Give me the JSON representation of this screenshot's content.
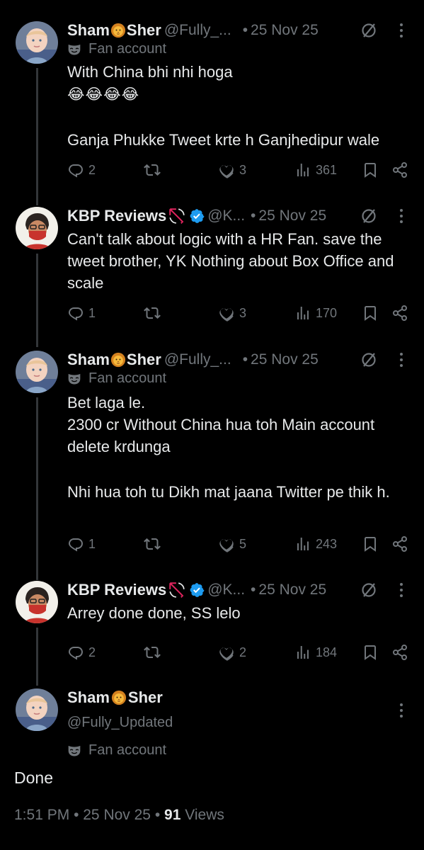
{
  "tweets": [
    {
      "name": "Sham",
      "name2": "Sher",
      "handle": "@Fully_...",
      "date": "25 Nov 25",
      "badge": "Fan account",
      "text": "With China bhi nhi hoga",
      "emoji_line": "😂😂😂😂",
      "text2": "Ganja Phukke Tweet krte h Ganjhedipur wale",
      "replies": "2",
      "likes": "3",
      "views": "361"
    },
    {
      "name": "KBP Reviews",
      "handle": "@K...",
      "date": "25 Nov 25",
      "text": "Can't talk about logic with a HR Fan. save the tweet brother, YK Nothing about Box Office and scale",
      "replies": "1",
      "likes": "3",
      "views": "170"
    },
    {
      "name": "Sham",
      "name2": "Sher",
      "handle": "@Fully_...",
      "date": "25 Nov 25",
      "badge": "Fan account",
      "text": "Bet laga le.\n2300 cr Without China hua toh Main account delete krdunga",
      "text2": "Nhi hua toh tu Dikh mat jaana Twitter pe thik h.",
      "replies": "1",
      "likes": "5",
      "views": "243"
    },
    {
      "name": "KBP Reviews",
      "handle": "@K...",
      "date": "25 Nov 25",
      "text": "Arrey done done, SS lelo",
      "replies": "2",
      "likes": "2",
      "views": "184"
    }
  ],
  "main": {
    "name": "Sham",
    "name2": "Sher",
    "handle": "@Fully_Updated",
    "badge": "Fan account",
    "text": "Done",
    "time": "1:51 PM",
    "date": "25 Nov 25",
    "views_count": "91",
    "views_label": "Views"
  },
  "colors": {
    "background": "#000000",
    "muted": "#71767b",
    "text": "#e7e9ea",
    "verified": "#1d9bf0"
  },
  "icons": [
    "reply-icon",
    "retweet-icon",
    "like-icon",
    "views-icon",
    "bookmark-icon",
    "share-icon",
    "grok-icon",
    "more-icon",
    "fan-mask-icon",
    "verified-icon",
    "lion-emoji",
    "bow-emoji"
  ]
}
